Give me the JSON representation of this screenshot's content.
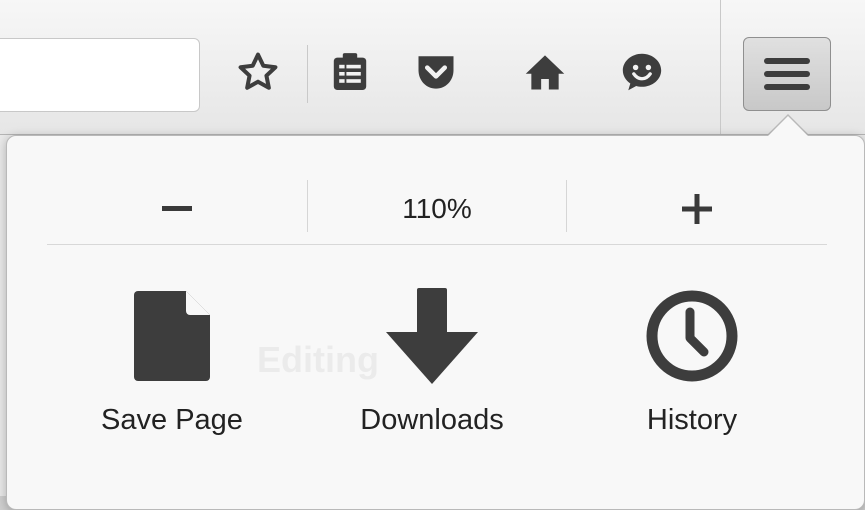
{
  "toolbar": {
    "icons": [
      "star-icon",
      "reading-list-icon",
      "pocket-icon",
      "home-icon",
      "emoji-icon"
    ],
    "menu_icon": "hamburger-menu-icon"
  },
  "panel": {
    "zoom": {
      "decrease_label": "−",
      "level": "110%",
      "increase_label": "+"
    },
    "items": [
      {
        "label": "Save Page",
        "icon": "save-page-icon"
      },
      {
        "label": "Downloads",
        "icon": "downloads-icon"
      },
      {
        "label": "History",
        "icon": "history-icon"
      }
    ]
  },
  "background": {
    "faded_text": "Editing"
  },
  "colors": {
    "icon": "#3d3d3d",
    "panel_bg": "#f8f8f8",
    "toolbar_bg": "#e6e6e6"
  }
}
